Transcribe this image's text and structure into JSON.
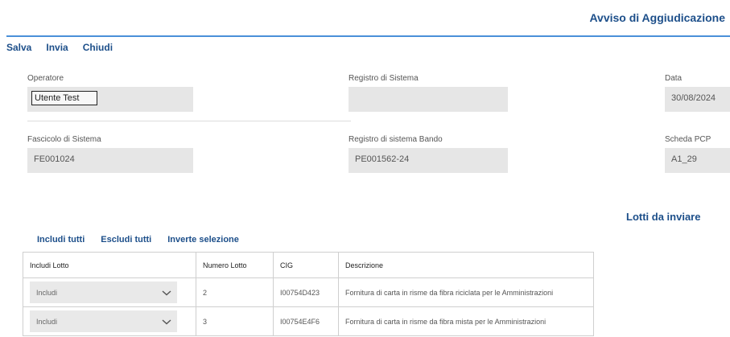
{
  "header": {
    "title": "Avviso di Aggiudicazione",
    "accent_color": "#4a90d9"
  },
  "toolbar": {
    "save": "Salva",
    "send": "Invia",
    "close": "Chiudi"
  },
  "fields": {
    "operatore": {
      "label": "Operatore",
      "value": "Utente Test"
    },
    "registro_sistema": {
      "label": "Registro di Sistema",
      "value": ""
    },
    "data": {
      "label": "Data",
      "value": "30/08/2024"
    },
    "fascicolo": {
      "label": "Fascicolo di Sistema",
      "value": "FE001024"
    },
    "registro_bando": {
      "label": "Registro di sistema Bando",
      "value": "PE001562-24"
    },
    "scheda_pcp": {
      "label": "Scheda PCP",
      "value": "A1_29"
    }
  },
  "lotti": {
    "title": "Lotti da inviare",
    "actions": {
      "include_all": "Includi tutti",
      "exclude_all": "Escludi tutti",
      "invert": "Inverte selezione"
    },
    "columns": [
      "Includi Lotto",
      "Numero Lotto",
      "CIG",
      "Descrizione"
    ],
    "rows": [
      {
        "includi": "Includi",
        "numero": "2",
        "cig": "I00754D423",
        "descrizione": "Fornitura di carta in risme da fibra riciclata per le Amministrazioni"
      },
      {
        "includi": "Includi",
        "numero": "3",
        "cig": "I00754E4F6",
        "descrizione": "Fornitura di carta in risme da fibra mista per le Amministrazioni"
      }
    ]
  }
}
